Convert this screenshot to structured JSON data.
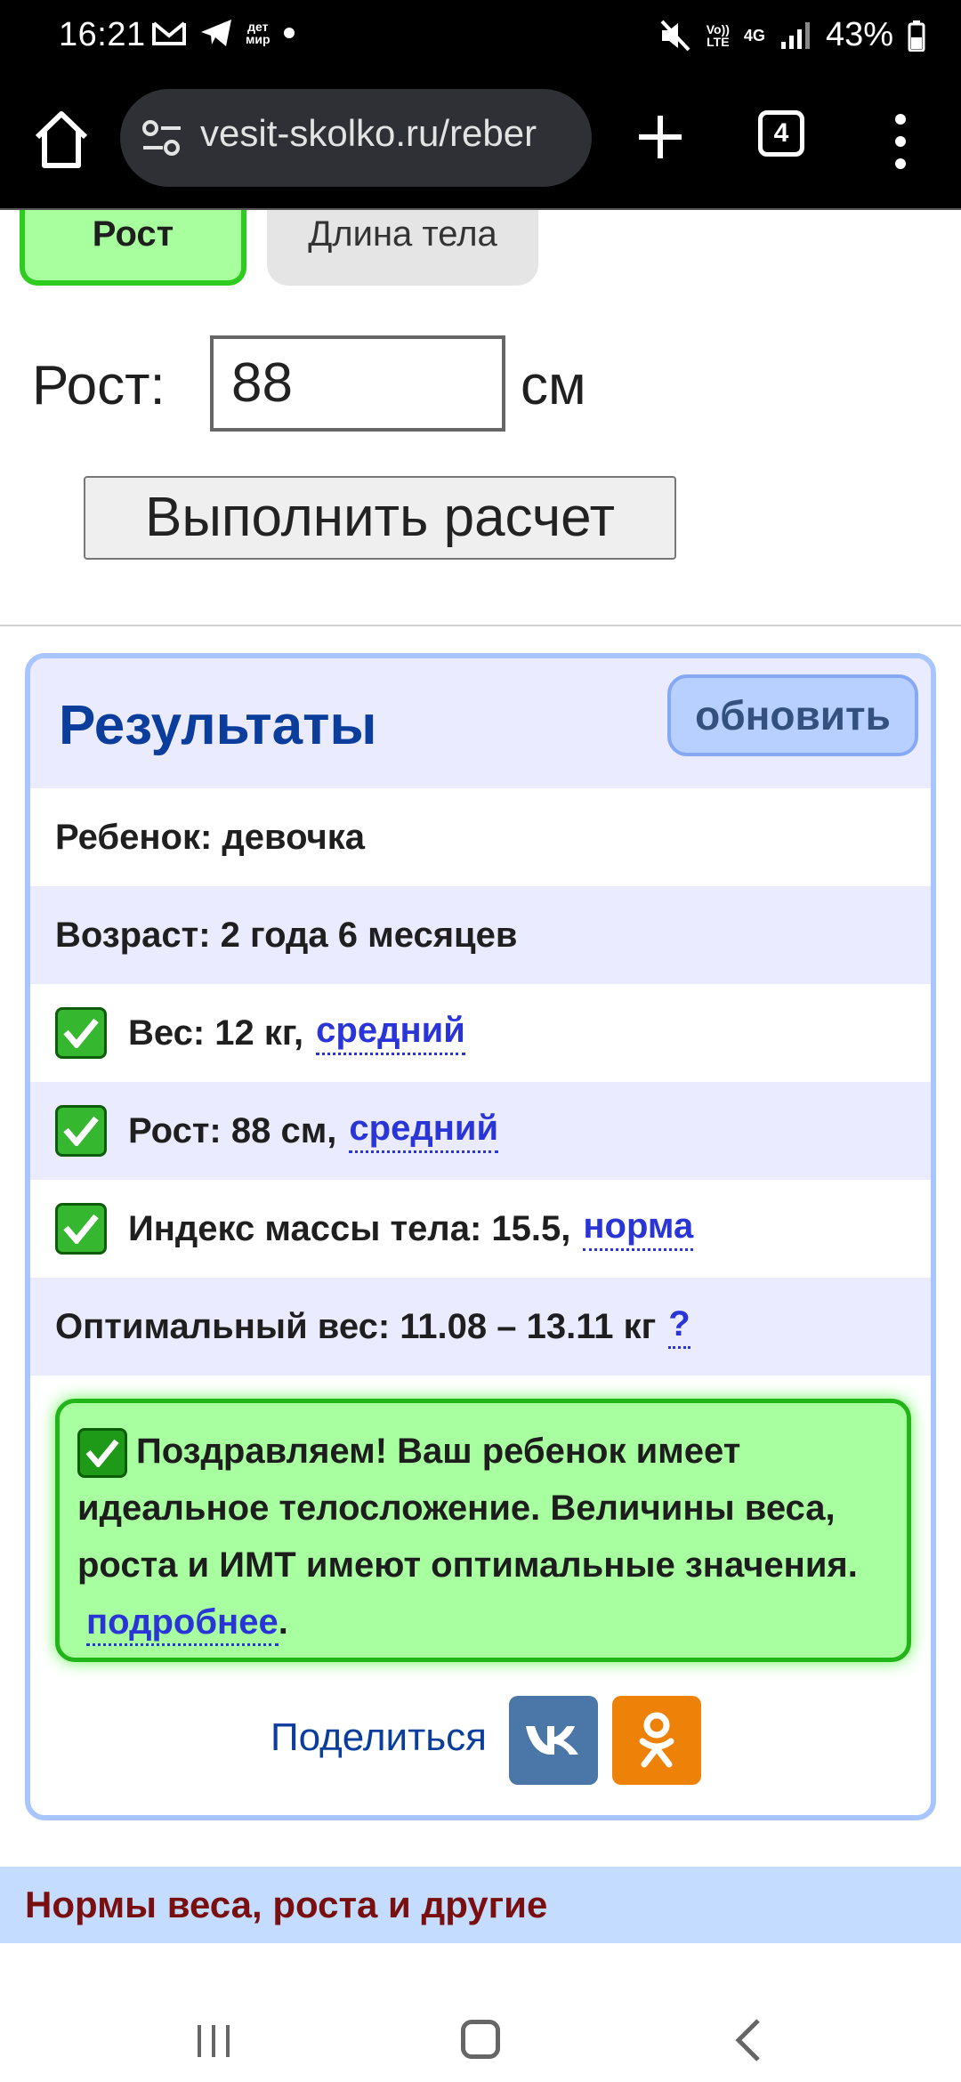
{
  "status_bar": {
    "time": "16:21",
    "notif_badge_line1": "дет",
    "notif_badge_line2": "мир",
    "volte_line1": "Vo))",
    "volte_line2": "LTE",
    "network": "4G",
    "battery": "43%"
  },
  "browser": {
    "url": "vesit-skolko.ru/reber",
    "tab_count": "4"
  },
  "mode_tabs": {
    "active": "Рост",
    "inactive": "Длина тела"
  },
  "form": {
    "height_label": "Рост:",
    "height_value": "88",
    "height_unit": "см",
    "calc_button": "Выполнить расчет"
  },
  "results": {
    "title": "Результаты",
    "refresh_button": "обновить",
    "child": "Ребенок: девочка",
    "age": "Возраст: 2 года 6 месяцев",
    "weight_text": "Вес: 12 кг,",
    "weight_link": "средний",
    "height_text": "Рост: 88 см,",
    "height_link": "средний",
    "bmi_text": "Индекс массы тела: 15.5,",
    "bmi_link": "норма",
    "optimal_weight": "Оптимальный вес: 11.08 – 13.11 кг",
    "optimal_help": "?",
    "congrats_text": "Поздравляем! Ваш ребенок имеет идеальное телосложение. Величины веса, роста и ИМТ имеют оптимальные значения.",
    "congrats_link": "подробнее",
    "congrats_end": ".",
    "share_label": "Поделиться"
  },
  "footer_section": {
    "title": "Нормы веса, роста и другие"
  },
  "colors": {
    "accent_green": "#2ecc1f",
    "title_blue": "#0a3d9c",
    "link_blue": "#2a35d8",
    "vk_blue": "#4a76a8",
    "ok_orange": "#ee8208"
  }
}
